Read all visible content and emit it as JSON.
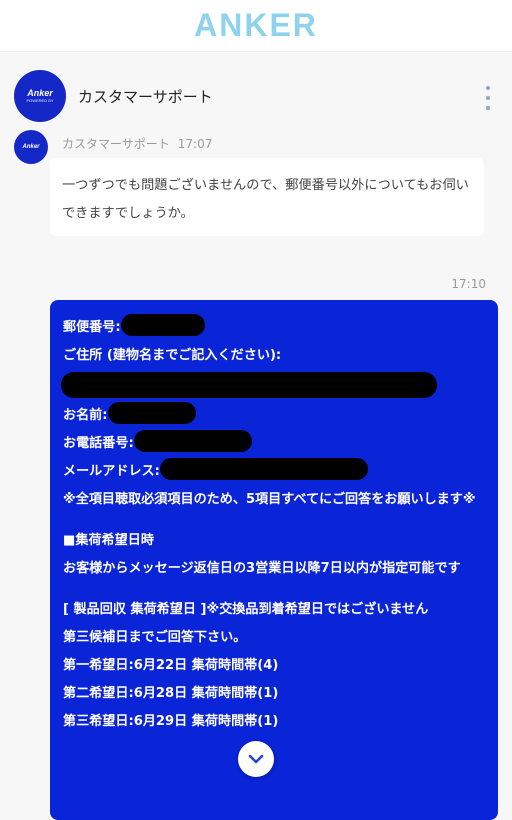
{
  "header": {
    "brand": "ANKER"
  },
  "chat": {
    "title": "カスタマーサポート",
    "menu_icon": "kebab-menu-icon",
    "avatar_label": "Anker",
    "avatar_sublabel": "POWERED BY"
  },
  "messages": {
    "agent": {
      "sender": "カスタマーサポート",
      "time": "17:07",
      "text": "一つずつでも問題ございませんので、郵便番号以外についてもお伺いできますでしょうか。"
    },
    "user": {
      "time": "17:10",
      "postal_label": "郵便番号:",
      "address_label": "ご住所 (建物名までご記入ください):",
      "name_label": "お名前:",
      "phone_label": "お電話番号:",
      "email_label": "メールアドレス:",
      "required_note": "※全項目聴取必須項目のため、5項目すべてにご回答をお願いします※",
      "pickup_heading": "■集荷希望日時",
      "pickup_desc": "お客様からメッセージ返信日の3営業日以降7日以内が指定可能です",
      "product_note": "[ 製品回収 集荷希望日 ]※交換品到着希望日ではございません",
      "candidates_note": "第三候補日までご回答下さい。",
      "choice1": "第一希望日:6月22日 集荷時間帯(4)",
      "choice2": "第二希望日:6月28日 集荷時間帯(1)",
      "choice3": "第三希望日:6月29日 集荷時間帯(1)"
    }
  },
  "scroll_button": {
    "icon": "chevron-down-icon"
  },
  "colors": {
    "brand": "#8fd2ee",
    "user_bubble": "#0a24d8",
    "avatar": "#1428c8"
  }
}
